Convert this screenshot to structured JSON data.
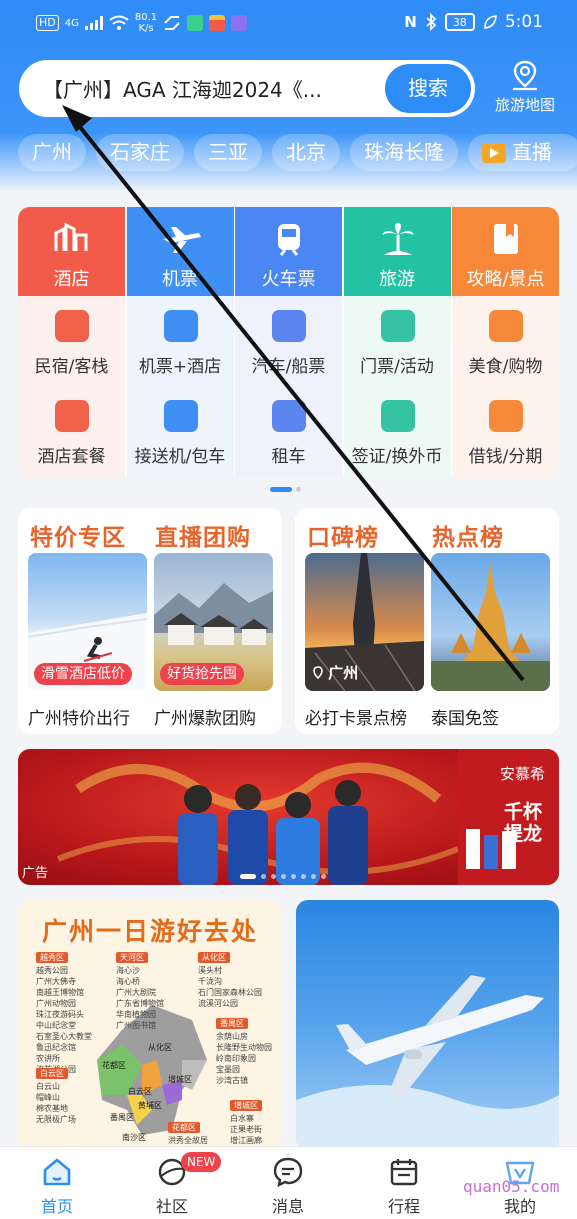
{
  "status_bar": {
    "hd": "HD",
    "net": "4G",
    "speed": "80.1",
    "speed_unit": "K/s",
    "battery": "38",
    "time": "5:01"
  },
  "header": {
    "search_query": "【广州】AGA 江海迦2024《...",
    "search_button": "搜索",
    "map_link": "旅游地图",
    "chips": [
      "广州",
      "石家庄",
      "三亚",
      "北京",
      "珠海长隆"
    ],
    "live_chip": "直播"
  },
  "services": {
    "columns": [
      {
        "main": {
          "label": "酒店",
          "icon": "hotel-icon",
          "color": "#f25b4a"
        },
        "items": [
          {
            "label": "民宿/客栈",
            "icon": "homestay-icon"
          },
          {
            "label": "酒店套餐",
            "icon": "hotel-package-icon"
          }
        ],
        "bg": "#fdf0ef"
      },
      {
        "main": {
          "label": "机票",
          "icon": "plane-icon",
          "color": "#3f8ff4"
        },
        "items": [
          {
            "label": "机票+酒店",
            "icon": "flight-hotel-icon"
          },
          {
            "label": "接送机/包车",
            "icon": "car-service-icon"
          }
        ],
        "bg": "#eef4fd"
      },
      {
        "main": {
          "label": "火车票",
          "icon": "train-icon",
          "color": "#4b87f2"
        },
        "items": [
          {
            "label": "汽车/船票",
            "icon": "bus-icon"
          },
          {
            "label": "租车",
            "icon": "car-rental-icon"
          }
        ],
        "bg": "#eff2fd"
      },
      {
        "main": {
          "label": "旅游",
          "icon": "palm-tree-icon",
          "color": "#23c2a3"
        },
        "items": [
          {
            "label": "门票/活动",
            "icon": "ticket-icon"
          },
          {
            "label": "签证/换外币",
            "icon": "visa-icon"
          }
        ],
        "bg": "#ecf9f5"
      },
      {
        "main": {
          "label": "攻略/景点",
          "icon": "guide-icon",
          "color": "#f7883a"
        },
        "items": [
          {
            "label": "美食/购物",
            "icon": "shopping-icon"
          },
          {
            "label": "借钱/分期",
            "icon": "money-bag-icon"
          }
        ],
        "bg": "#fdf3ec"
      }
    ]
  },
  "promo": {
    "left": {
      "titles": [
        "特价专区",
        "直播团购"
      ],
      "items": [
        {
          "tag": "滑雪酒店低价",
          "caption": "广州特价出行"
        },
        {
          "tag": "好货抢先囤",
          "caption": "广州爆款团购"
        }
      ]
    },
    "right": {
      "titles": [
        "口碑榜",
        "热点榜"
      ],
      "items": [
        {
          "location": "广州",
          "caption": "必打卡景点榜"
        },
        {
          "caption": "泰国免签"
        }
      ]
    }
  },
  "ad": {
    "brand": "安慕希",
    "slogan": "千杯提龙",
    "label": "广告",
    "slides": 8,
    "active_slide": 0
  },
  "feed": {
    "guide_title": "广州一日游好去处",
    "districts": [
      {
        "name": "越秀区",
        "places": [
          "越秀公园",
          "广州大佛寺",
          "南越王博物馆",
          "广州动物园",
          "珠江夜游码头",
          "中山纪念堂",
          "石室圣心大教堂",
          "鲁迅纪念馆",
          "农讲所",
          "流花湖公园"
        ]
      },
      {
        "name": "天河区",
        "places": [
          "海心沙",
          "海心桥",
          "广州大剧院",
          "广东省博物馆",
          "华南植物园",
          "广州图书馆"
        ]
      },
      {
        "name": "从化区",
        "places": [
          "溪头村",
          "千泷沟",
          "石门国家森林公园",
          "流溪河公园"
        ]
      },
      {
        "name": "白云区",
        "places": [
          "白云山",
          "帽峰山",
          "棉农基地",
          "无限极广场"
        ]
      },
      {
        "name": "番禺区",
        "places": [
          "余荫山房",
          "长隆野生动物园",
          "岭南印象园",
          "宝墨园",
          "沙湾古镇"
        ]
      },
      {
        "name": "增城区",
        "places": [
          "白水寨",
          "正果老街",
          "增江画廊"
        ]
      },
      {
        "name": "花都区",
        "places": [
          "",
          "洪秀全故居"
        ]
      }
    ],
    "map_labels": [
      "从化区",
      "花都区",
      "白云区",
      "增城区",
      "黄埔区",
      "番禺区",
      "南沙区"
    ]
  },
  "tabbar": {
    "tabs": [
      {
        "label": "首页",
        "icon": "home-icon",
        "active": true
      },
      {
        "label": "社区",
        "icon": "community-icon",
        "active": false
      },
      {
        "label": "消息",
        "icon": "message-icon",
        "active": false
      },
      {
        "label": "行程",
        "icon": "calendar-icon",
        "active": false
      },
      {
        "label": "我的",
        "icon": "profile-icon",
        "active": false
      }
    ],
    "new_badge": "NEW",
    "watermark": "quan05.com"
  }
}
